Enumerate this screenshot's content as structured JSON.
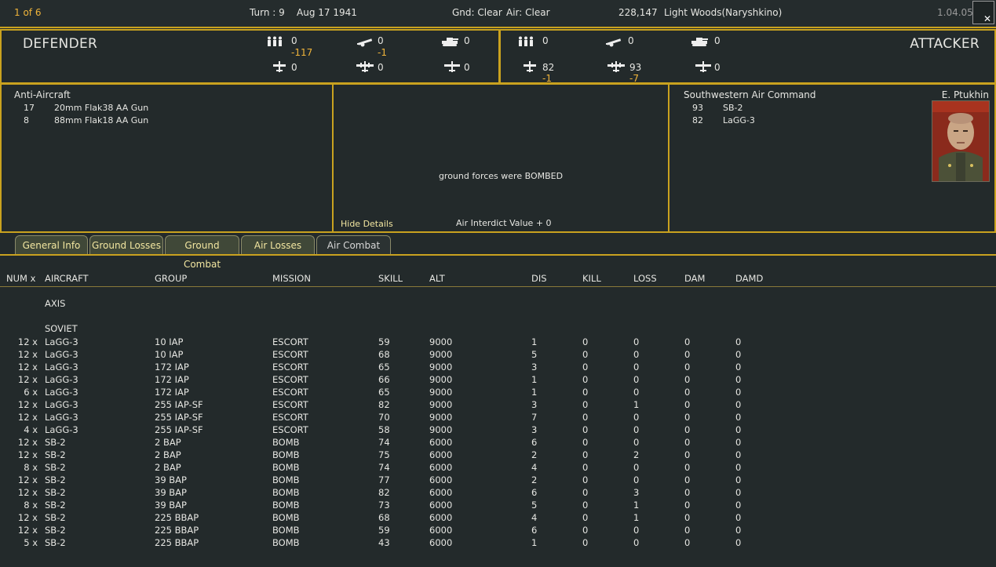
{
  "topbar": {
    "page_indicator": "1 of 6",
    "turn": "Turn : 9",
    "date": "Aug 17 1941",
    "ground_weather": "Gnd: Clear",
    "air_weather": "Air: Clear",
    "hex_coords": "228,147",
    "terrain": "Light Woods(Naryshkino)",
    "version": "1.04.05",
    "close_glyph": "✕"
  },
  "defender": {
    "title": "DEFENDER",
    "men": "0",
    "men_delta": "-117",
    "guns": "0",
    "guns_delta": "-1",
    "tanks": "0",
    "fighters": "0",
    "bombers": "0",
    "other_air": "0"
  },
  "attacker": {
    "title": "ATTACKER",
    "men": "0",
    "guns": "0",
    "tanks": "0",
    "fighters": "82",
    "fighters_delta": "-1",
    "bombers": "93",
    "bombers_delta": "-7",
    "other_air": "0"
  },
  "defender_units": {
    "header": "Anti-Aircraft",
    "rows": [
      {
        "count": "17",
        "name": "20mm Flak38 AA Gun"
      },
      {
        "count": "8",
        "name": "88mm Flak18 AA Gun"
      }
    ]
  },
  "center_panel": {
    "message": "ground forces were BOMBED",
    "hide_details": "Hide Details",
    "interdict": "Air Interdict Value  + 0"
  },
  "attacker_units": {
    "header": "Southwestern Air Command",
    "commander": "E. Ptukhin",
    "rows": [
      {
        "count": "93",
        "name": "SB-2"
      },
      {
        "count": "82",
        "name": "LaGG-3"
      }
    ]
  },
  "tabs": [
    "General Info",
    "Ground Losses",
    "Ground Combat",
    "Air Losses",
    "Air Combat"
  ],
  "active_tab": "Air Combat",
  "table": {
    "headers": [
      "NUM x",
      "AIRCRAFT",
      "GROUP",
      "MISSION",
      "SKILL",
      "ALT",
      "DIS",
      "KILL",
      "LOSS",
      "DAM",
      "DAMD"
    ],
    "section_axis": "AXIS",
    "section_soviet": "SOVIET",
    "rows": [
      [
        "12 x",
        "LaGG-3",
        "10 IAP",
        "ESCORT",
        "59",
        "9000",
        "1",
        "0",
        "0",
        "0",
        "0"
      ],
      [
        "12 x",
        "LaGG-3",
        "10 IAP",
        "ESCORT",
        "68",
        "9000",
        "5",
        "0",
        "0",
        "0",
        "0"
      ],
      [
        "12 x",
        "LaGG-3",
        "172 IAP",
        "ESCORT",
        "65",
        "9000",
        "3",
        "0",
        "0",
        "0",
        "0"
      ],
      [
        "12 x",
        "LaGG-3",
        "172 IAP",
        "ESCORT",
        "66",
        "9000",
        "1",
        "0",
        "0",
        "0",
        "0"
      ],
      [
        "6 x",
        "LaGG-3",
        "172 IAP",
        "ESCORT",
        "65",
        "9000",
        "1",
        "0",
        "0",
        "0",
        "0"
      ],
      [
        "12 x",
        "LaGG-3",
        "255 IAP-SF",
        "ESCORT",
        "82",
        "9000",
        "3",
        "0",
        "1",
        "0",
        "0"
      ],
      [
        "12 x",
        "LaGG-3",
        "255 IAP-SF",
        "ESCORT",
        "70",
        "9000",
        "7",
        "0",
        "0",
        "0",
        "0"
      ],
      [
        "4 x",
        "LaGG-3",
        "255 IAP-SF",
        "ESCORT",
        "58",
        "9000",
        "3",
        "0",
        "0",
        "0",
        "0"
      ],
      [
        "12 x",
        "SB-2",
        "2 BAP",
        "BOMB",
        "74",
        "6000",
        "6",
        "0",
        "0",
        "0",
        "0"
      ],
      [
        "12 x",
        "SB-2",
        "2 BAP",
        "BOMB",
        "75",
        "6000",
        "2",
        "0",
        "2",
        "0",
        "0"
      ],
      [
        "8 x",
        "SB-2",
        "2 BAP",
        "BOMB",
        "74",
        "6000",
        "4",
        "0",
        "0",
        "0",
        "0"
      ],
      [
        "12 x",
        "SB-2",
        "39 BAP",
        "BOMB",
        "77",
        "6000",
        "2",
        "0",
        "0",
        "0",
        "0"
      ],
      [
        "12 x",
        "SB-2",
        "39 BAP",
        "BOMB",
        "82",
        "6000",
        "6",
        "0",
        "3",
        "0",
        "0"
      ],
      [
        "8 x",
        "SB-2",
        "39 BAP",
        "BOMB",
        "73",
        "6000",
        "5",
        "0",
        "1",
        "0",
        "0"
      ],
      [
        "12 x",
        "SB-2",
        "225 BBAP",
        "BOMB",
        "68",
        "6000",
        "4",
        "0",
        "1",
        "0",
        "0"
      ],
      [
        "12 x",
        "SB-2",
        "225 BBAP",
        "BOMB",
        "59",
        "6000",
        "6",
        "0",
        "0",
        "0",
        "0"
      ],
      [
        "5 x",
        "SB-2",
        "225 BBAP",
        "BOMB",
        "43",
        "6000",
        "1",
        "0",
        "0",
        "0",
        "0"
      ]
    ]
  },
  "colors": {
    "accent": "#c9a21f",
    "delta": "#f0b43a",
    "tab": "#404838",
    "background": "#232a2b"
  }
}
